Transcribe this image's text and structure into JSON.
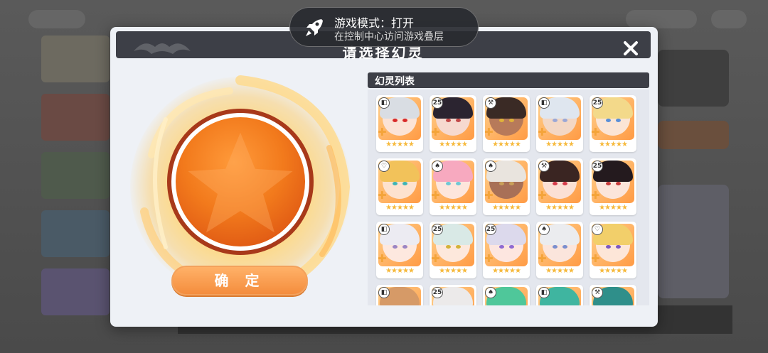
{
  "dialog": {
    "title": "请选择幻灵",
    "close_icon": "close-icon",
    "confirm_label": "确 定"
  },
  "list": {
    "title": "幻灵列表",
    "stars_text": "★★★★★",
    "plus_text": "✚",
    "cards": [
      {
        "badge": "◧",
        "hair": "#d9dde3",
        "skin": "#fbe3d6",
        "eye": "#d82a2a"
      },
      {
        "badge": "25",
        "hair": "#2b2430",
        "skin": "#f6d9cf",
        "eye": "#c24848"
      },
      {
        "badge": "⚒",
        "hair": "#3a2a25",
        "skin": "#b77a5a",
        "eye": "#e0b23a"
      },
      {
        "badge": "◧",
        "hair": "#dfe6ef",
        "skin": "#f3d7c4",
        "eye": "#9aa7d6"
      },
      {
        "badge": "25",
        "hair": "#f3d98a",
        "skin": "#fbe5d5",
        "eye": "#5a8fd8"
      },
      {
        "badge": "♡",
        "hair": "#f2c25a",
        "skin": "#fde2cf",
        "eye": "#3fb5b6"
      },
      {
        "badge": "♠",
        "hair": "#f7a9bf",
        "skin": "#fde6dc",
        "eye": "#6fc8d6"
      },
      {
        "badge": "♠",
        "hair": "#e9e4de",
        "skin": "#a87057",
        "eye": "#c9a05a"
      },
      {
        "badge": "⚒",
        "hair": "#3a2522",
        "skin": "#fbe0d4",
        "eye": "#d43b4a"
      },
      {
        "badge": "25",
        "hair": "#241a1e",
        "skin": "#fbe5da",
        "eye": "#c53a3a"
      },
      {
        "badge": "◧",
        "hair": "#ecebf2",
        "skin": "#fde8df",
        "eye": "#9b86c4"
      },
      {
        "badge": "25",
        "hair": "#d9e9e6",
        "skin": "#fde8dc",
        "eye": "#d2b23a"
      },
      {
        "badge": "25",
        "hair": "#dcd9ec",
        "skin": "#fde6e0",
        "eye": "#8f6ad2"
      },
      {
        "badge": "♠",
        "hair": "#ebecef",
        "skin": "#fbe5dc",
        "eye": "#7a8fcf"
      },
      {
        "badge": "♡",
        "hair": "#f2cf6a",
        "skin": "#fde6d8",
        "eye": "#7c5ac0"
      },
      {
        "badge": "◧",
        "hair": "#d69a67",
        "skin": "#e8b898",
        "eye": "#7a4a2a"
      },
      {
        "badge": "25",
        "hair": "#eceaea",
        "skin": "#f6e2d8",
        "eye": "#777777"
      },
      {
        "badge": "♠",
        "hair": "#4fc79a",
        "skin": "#f6e1d5",
        "eye": "#2f8f6a"
      },
      {
        "badge": "◧",
        "hair": "#3fb5a0",
        "skin": "#f5e0d3",
        "eye": "#2a7f70"
      },
      {
        "badge": "⚒",
        "hair": "#2f8f8a",
        "skin": "#f5e0d3",
        "eye": "#1f6f6a"
      }
    ]
  },
  "toast": {
    "title": "游戏模式：打开",
    "subtitle": "在控制中心访问游戏叠层",
    "icon": "rocket-icon"
  }
}
